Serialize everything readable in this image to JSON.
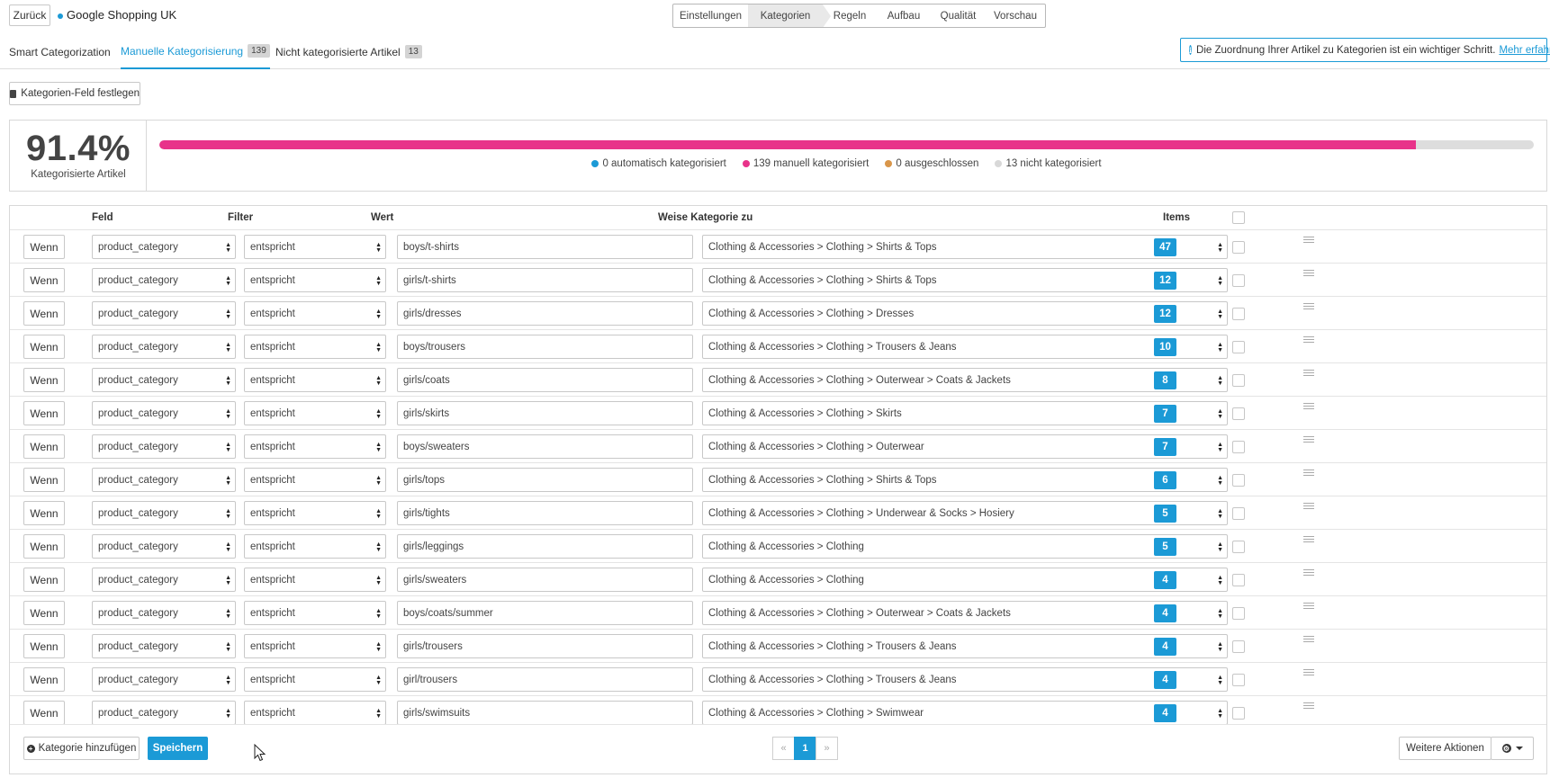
{
  "header": {
    "back_label": "Zurück",
    "feed_name": "Google Shopping UK",
    "steps": [
      "Einstellungen",
      "Kategorien",
      "Regeln",
      "Aufbau",
      "Qualität",
      "Vorschau"
    ],
    "active_step": "Kategorien"
  },
  "tabs": [
    {
      "label": "Smart Categorization",
      "count": ""
    },
    {
      "label": "Manuelle Kategorisierung",
      "count": "139"
    },
    {
      "label": "Nicht kategorisierte Artikel",
      "count": "13"
    }
  ],
  "active_tab": "Manuelle Kategorisierung",
  "info": {
    "text": "Die Zuordnung Ihrer Artikel zu Kategorien ist ein wichtiger Schritt.",
    "link": "Mehr erfahren",
    "trailing": "."
  },
  "field_button_label": "Kategorien-Feld festlegen",
  "stats": {
    "percent": "91.4%",
    "label": "Kategorisierte Artikel",
    "progress_fraction": 0.914,
    "colors": {
      "auto": "#1b9ad6",
      "manual": "#e8338a",
      "excluded": "#d9964a",
      "uncategorized": "#d8d8d8"
    },
    "legend": [
      {
        "key": "auto",
        "text": "0 automatisch kategorisiert"
      },
      {
        "key": "manual",
        "text": "139 manuell kategorisiert"
      },
      {
        "key": "excluded",
        "text": "0 ausgeschlossen"
      },
      {
        "key": "uncategorized",
        "text": "13 nicht kategorisiert"
      }
    ]
  },
  "table": {
    "headers": {
      "feld": "Feld",
      "filter": "Filter",
      "wert": "Wert",
      "category": "Weise Kategorie zu",
      "items": "Items"
    },
    "rows": [
      {
        "cond": "Wenn",
        "field": "product_category",
        "filter": "entspricht",
        "value": "boys/t-shirts",
        "category": "Clothing & Accessories > Clothing > Shirts & Tops",
        "items": "47"
      },
      {
        "cond": "Wenn",
        "field": "product_category",
        "filter": "entspricht",
        "value": "girls/t-shirts",
        "category": "Clothing & Accessories > Clothing > Shirts & Tops",
        "items": "12"
      },
      {
        "cond": "Wenn",
        "field": "product_category",
        "filter": "entspricht",
        "value": "girls/dresses",
        "category": "Clothing & Accessories > Clothing > Dresses",
        "items": "12"
      },
      {
        "cond": "Wenn",
        "field": "product_category",
        "filter": "entspricht",
        "value": "boys/trousers",
        "category": "Clothing & Accessories > Clothing > Trousers & Jeans",
        "items": "10"
      },
      {
        "cond": "Wenn",
        "field": "product_category",
        "filter": "entspricht",
        "value": "girls/coats",
        "category": "Clothing & Accessories > Clothing > Outerwear > Coats & Jackets",
        "items": "8"
      },
      {
        "cond": "Wenn",
        "field": "product_category",
        "filter": "entspricht",
        "value": "girls/skirts",
        "category": "Clothing & Accessories > Clothing > Skirts",
        "items": "7"
      },
      {
        "cond": "Wenn",
        "field": "product_category",
        "filter": "entspricht",
        "value": "boys/sweaters",
        "category": "Clothing & Accessories > Clothing > Outerwear",
        "items": "7"
      },
      {
        "cond": "Wenn",
        "field": "product_category",
        "filter": "entspricht",
        "value": "girls/tops",
        "category": "Clothing & Accessories > Clothing > Shirts & Tops",
        "items": "6"
      },
      {
        "cond": "Wenn",
        "field": "product_category",
        "filter": "entspricht",
        "value": "girls/tights",
        "category": "Clothing & Accessories > Clothing > Underwear & Socks > Hosiery",
        "items": "5"
      },
      {
        "cond": "Wenn",
        "field": "product_category",
        "filter": "entspricht",
        "value": "girls/leggings",
        "category": "Clothing & Accessories > Clothing",
        "items": "5"
      },
      {
        "cond": "Wenn",
        "field": "product_category",
        "filter": "entspricht",
        "value": "girls/sweaters",
        "category": "Clothing & Accessories > Clothing",
        "items": "4"
      },
      {
        "cond": "Wenn",
        "field": "product_category",
        "filter": "entspricht",
        "value": "boys/coats/summer",
        "category": "Clothing & Accessories > Clothing > Outerwear > Coats & Jackets",
        "items": "4"
      },
      {
        "cond": "Wenn",
        "field": "product_category",
        "filter": "entspricht",
        "value": "girls/trousers",
        "category": "Clothing & Accessories > Clothing > Trousers & Jeans",
        "items": "4"
      },
      {
        "cond": "Wenn",
        "field": "product_category",
        "filter": "entspricht",
        "value": "girl/trousers",
        "category": "Clothing & Accessories > Clothing > Trousers & Jeans",
        "items": "4"
      },
      {
        "cond": "Wenn",
        "field": "product_category",
        "filter": "entspricht",
        "value": "girls/swimsuits",
        "category": "Clothing & Accessories > Clothing > Swimwear",
        "items": "4"
      }
    ]
  },
  "footer": {
    "add_label": "Kategorie hinzufügen",
    "save_label": "Speichern",
    "pagination": {
      "prev": "«",
      "current": "1",
      "next": "»"
    },
    "more_label": "Weitere Aktionen"
  }
}
